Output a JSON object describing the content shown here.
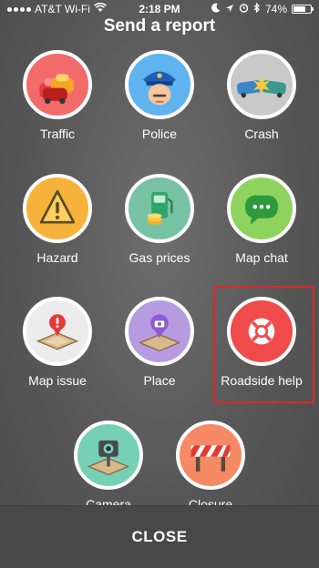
{
  "status_bar": {
    "carrier": "AT&T Wi-Fi",
    "time": "2:18 PM",
    "battery_percent": "74%",
    "battery_level": 0.74
  },
  "title": "Send a report",
  "items": [
    {
      "label": "Traffic",
      "icon": "traffic-icon",
      "color": "#f26a6a"
    },
    {
      "label": "Police",
      "icon": "police-icon",
      "color": "#5fb4ef"
    },
    {
      "label": "Crash",
      "icon": "crash-icon",
      "color": "#c9c9c9"
    },
    {
      "label": "Hazard",
      "icon": "hazard-icon",
      "color": "#f6b23a"
    },
    {
      "label": "Gas prices",
      "icon": "gas-prices-icon",
      "color": "#78c2a4"
    },
    {
      "label": "Map chat",
      "icon": "map-chat-icon",
      "color": "#8ed35e"
    },
    {
      "label": "Map issue",
      "icon": "map-issue-icon",
      "color": "#ececec"
    },
    {
      "label": "Place",
      "icon": "place-icon",
      "color": "#b79be0"
    },
    {
      "label": "Roadside help",
      "icon": "roadside-help-icon",
      "color": "#f04b4b"
    },
    {
      "label": "Camera",
      "icon": "camera-icon",
      "color": "#76d0b5"
    },
    {
      "label": "Closure",
      "icon": "closure-icon",
      "color": "#f58a64"
    }
  ],
  "close_label": "CLOSE",
  "highlight_color": "#e0252a"
}
